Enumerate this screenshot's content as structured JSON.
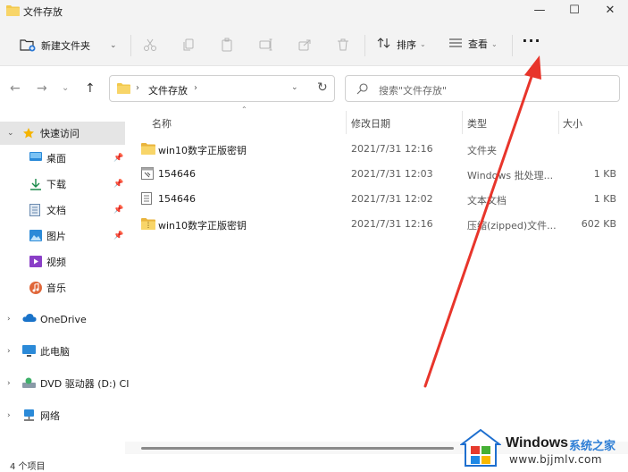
{
  "window": {
    "title": "文件存放"
  },
  "toolbar": {
    "new_folder_label": "新建文件夹",
    "sort_label": "排序",
    "view_label": "查看",
    "more_label": "···"
  },
  "address": {
    "path_segment": "文件存放",
    "search_placeholder": "搜索\"文件存放\""
  },
  "sidebar": {
    "quick_access": "快速访问",
    "items": [
      {
        "label": "桌面",
        "icon": "desktop-icon",
        "pinned": true
      },
      {
        "label": "下载",
        "icon": "download-icon",
        "pinned": true
      },
      {
        "label": "文档",
        "icon": "document-icon",
        "pinned": true
      },
      {
        "label": "图片",
        "icon": "picture-icon",
        "pinned": true
      },
      {
        "label": "视频",
        "icon": "video-icon",
        "pinned": false
      },
      {
        "label": "音乐",
        "icon": "music-icon",
        "pinned": false
      }
    ],
    "onedrive": "OneDrive",
    "this_pc": "此电脑",
    "dvd": "DVD 驱动器 (D:) CI",
    "network": "网络"
  },
  "columns": {
    "name": "名称",
    "date": "修改日期",
    "type": "类型",
    "size": "大小"
  },
  "files": [
    {
      "name": "win10数字正版密钥",
      "date": "2021/7/31 12:16",
      "type": "文件夹",
      "size": "",
      "icon": "folder-icon"
    },
    {
      "name": "154646",
      "date": "2021/7/31 12:03",
      "type": "Windows 批处理...",
      "size": "1 KB",
      "icon": "batch-file-icon"
    },
    {
      "name": "154646",
      "date": "2021/7/31 12:02",
      "type": "文本文档",
      "size": "1 KB",
      "icon": "text-file-icon"
    },
    {
      "name": "win10数字正版密钥",
      "date": "2021/7/31 12:16",
      "type": "压缩(zipped)文件...",
      "size": "602 KB",
      "icon": "zip-folder-icon"
    }
  ],
  "status": {
    "item_count": "4 个项目"
  },
  "watermark": {
    "brand": "Windows",
    "cn": "系统之家",
    "url": "www.bjjmlv.com"
  },
  "colors": {
    "accent_arrow": "#e8352b",
    "folder": "#f2c94c",
    "selected_bg": "#e5e5e5"
  }
}
